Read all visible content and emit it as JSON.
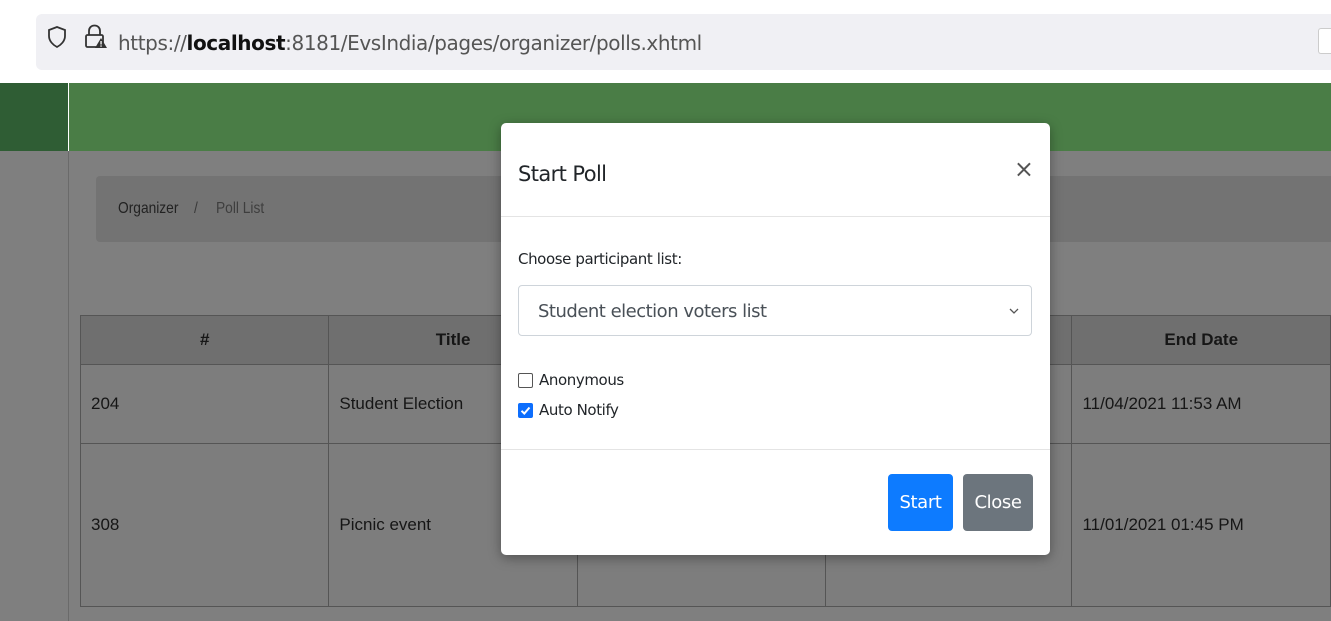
{
  "browser": {
    "url_prefix": "https://",
    "url_host": "localhost",
    "url_rest": ":8181/EvsIndia/pages/organizer/polls.xhtml"
  },
  "breadcrumb": {
    "items": [
      "Organizer",
      "Poll List"
    ],
    "separator": "/"
  },
  "table": {
    "columns": [
      "#",
      "Title",
      "",
      "",
      "End Date"
    ],
    "rows": [
      {
        "id": "204",
        "title": "Student Election",
        "col3": "",
        "col4": "",
        "end_date": "11/04/2021 11:53 AM"
      },
      {
        "id": "308",
        "title": "Picnic event",
        "col3": "",
        "col4": "",
        "end_date": "11/01/2021 01:45 PM"
      }
    ]
  },
  "modal": {
    "title": "Start Poll",
    "close_glyph": "×",
    "participant_label": "Choose participant list:",
    "participant_selected": "Student election voters list",
    "options": [
      {
        "label": "Anonymous",
        "checked": false
      },
      {
        "label": "Auto Notify",
        "checked": true
      }
    ],
    "start_label": "Start",
    "close_label": "Close"
  },
  "colors": {
    "header_green": "#4a7d46",
    "sidebar_dark": "#2f5d34",
    "primary": "#0d7bff",
    "secondary": "#6c757d",
    "overlay": "#7f7f7f"
  },
  "icons": [
    "shield-icon",
    "lock-icon",
    "close-icon",
    "chevron-down-icon",
    "checkmark-icon"
  ]
}
